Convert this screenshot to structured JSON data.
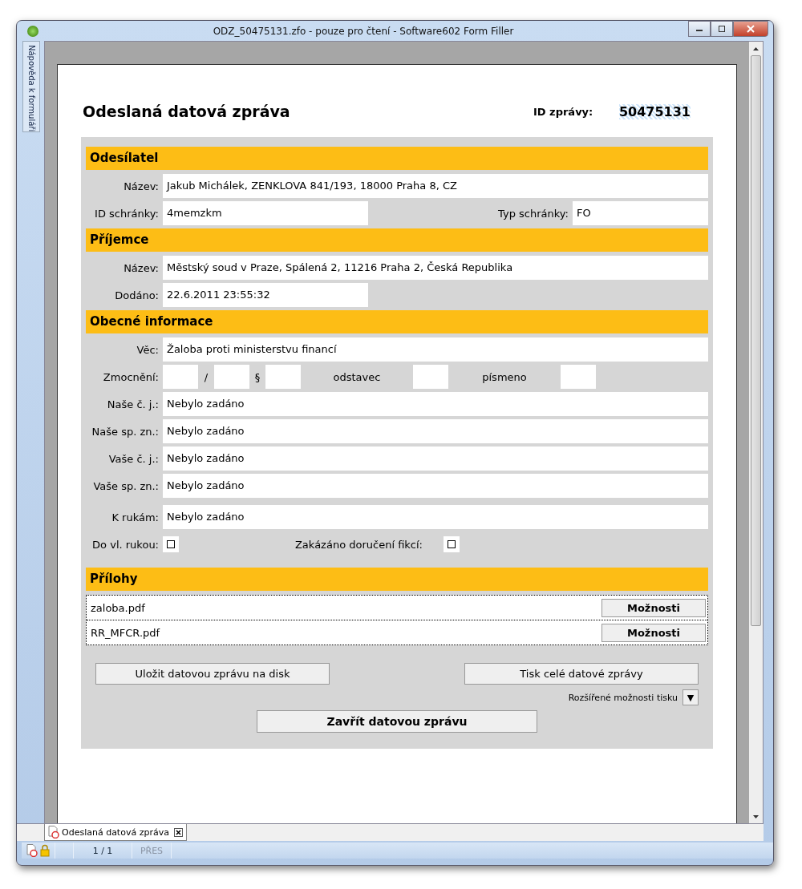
{
  "window": {
    "title": "ODZ_50475131.zfo - pouze pro čtení - Software602 Form Filler"
  },
  "help_tab": {
    "label": "Nápověda k formuláři"
  },
  "form": {
    "title": "Odeslaná datová zpráva",
    "id_label": "ID zprávy:",
    "id_value": "50475131"
  },
  "sections": [
    {
      "header": "Odesílatel",
      "rows": [
        {
          "kind": "field",
          "label": "Název:",
          "value": "Jakub Michálek, ZENKLOVA 841/193, 18000 Praha 8, CZ"
        },
        {
          "kind": "pair",
          "label": "ID schránky:",
          "value": "4memzkm",
          "label2": "Typ schránky:",
          "value2": "FO"
        }
      ]
    },
    {
      "header": "Příjemce",
      "rows": [
        {
          "kind": "field",
          "label": "Název:",
          "value": "Městský soud v Praze, Spálená 2, 11216 Praha 2, Česká Republika"
        },
        {
          "kind": "short",
          "label": "Dodáno:",
          "value": "22.6.2011 23:55:32"
        }
      ]
    },
    {
      "header": "Obecné informace",
      "rows": [
        {
          "kind": "field",
          "label": "Věc:",
          "value": "Žaloba proti ministerstvu financí"
        },
        {
          "kind": "authorization",
          "label": "Zmocnění:",
          "parts": [
            "/",
            "§",
            "odstavec",
            "písmeno"
          ]
        },
        {
          "kind": "field",
          "label": "Naše č. j.:",
          "value": "Nebylo zadáno"
        },
        {
          "kind": "field",
          "label": "Naše sp. zn.:",
          "value": "Nebylo zadáno"
        },
        {
          "kind": "field",
          "label": "Vaše č. j.:",
          "value": "Nebylo zadáno"
        },
        {
          "kind": "field",
          "label": "Vaše sp. zn.:",
          "value": "Nebylo zadáno"
        },
        {
          "kind": "field",
          "label": "K rukám:",
          "value": "Nebylo zadáno"
        },
        {
          "kind": "checks",
          "items": [
            {
              "label": "Do vl. rukou:",
              "checked": false
            },
            {
              "label": "Zakázáno doručení fikcí:",
              "checked": false
            }
          ]
        }
      ]
    }
  ],
  "attachments": {
    "header": "Přílohy",
    "items": [
      {
        "name": "zaloba.pdf",
        "button": "Možnosti"
      },
      {
        "name": "RR_MFCR.pdf",
        "button": "Možnosti"
      }
    ]
  },
  "buttons": {
    "save": "Uložit datovou zprávu na disk",
    "print": "Tisk celé datové zprávy",
    "print_options": "Rozšířené možnosti tisku",
    "print_options_toggle": "▼",
    "close": "Zavřít datovou zprávu"
  },
  "doc_tab": {
    "label": "Odeslaná datová zpráva"
  },
  "status_bar": {
    "page": "1 / 1",
    "mode": "PŘES",
    "mode_disabled": true
  }
}
